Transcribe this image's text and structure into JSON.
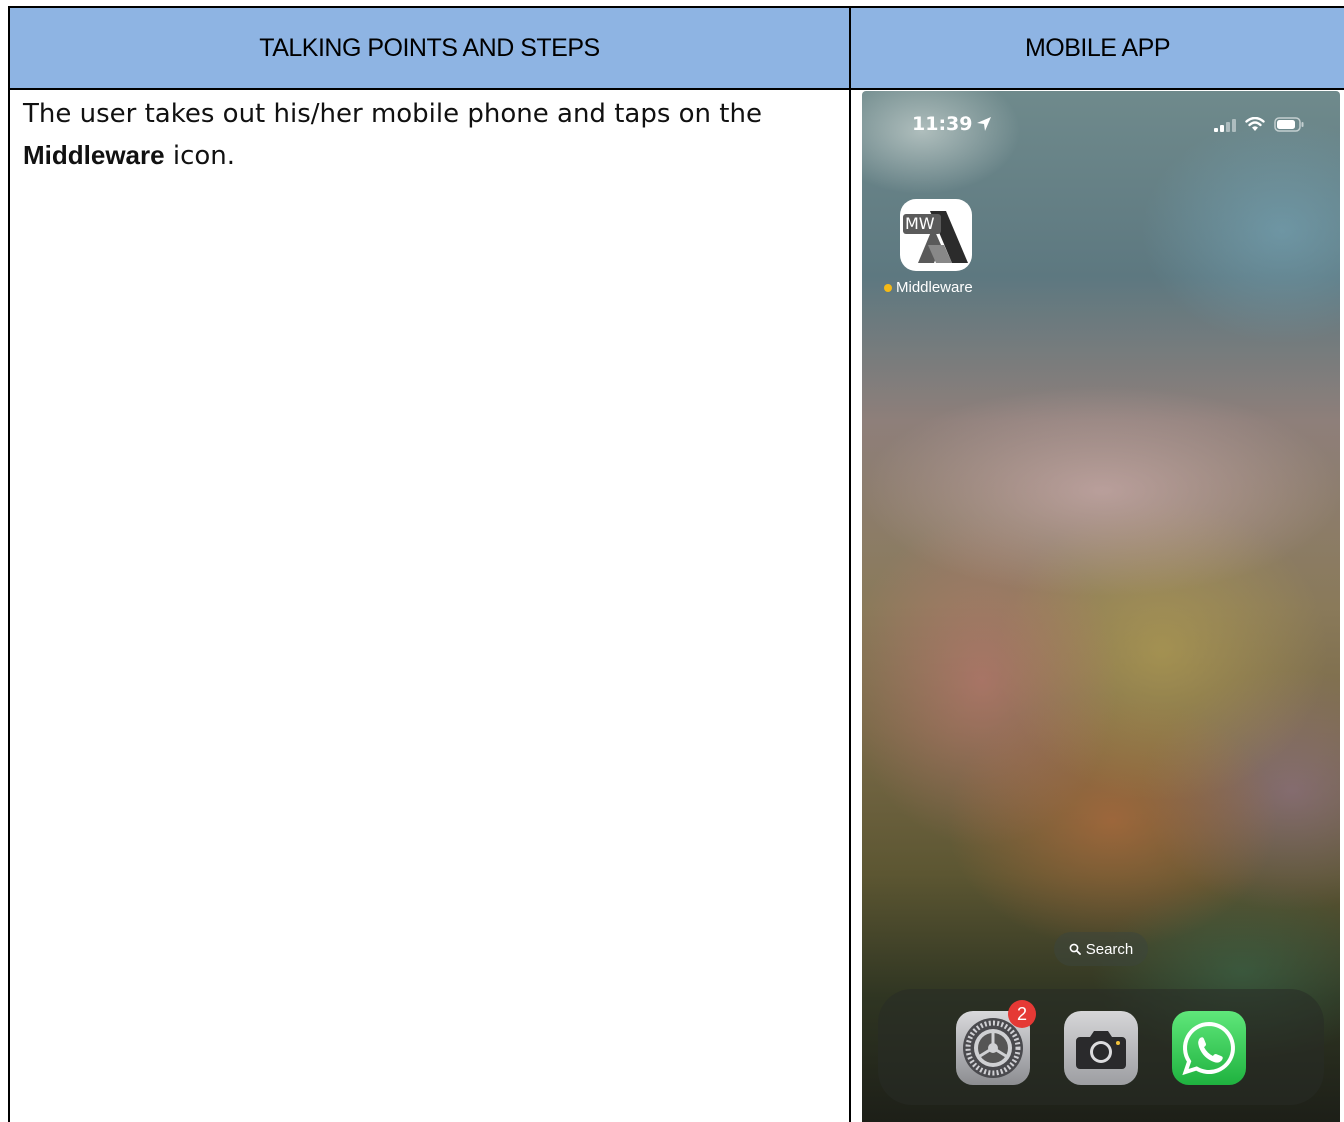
{
  "table": {
    "col1_header": "TALKING POINTS AND STEPS",
    "col2_header": "MOBILE APP",
    "step_text_before": "The user takes out his/her mobile phone and taps on the ",
    "step_text_bold": "Middleware",
    "step_text_after": " icon."
  },
  "phone": {
    "status_time": "11:39",
    "app_icon_text": "MW",
    "app_label": "Middleware",
    "search_label": "Search",
    "settings_badge": "2",
    "dock_apps": [
      "Settings",
      "Camera",
      "WhatsApp"
    ]
  },
  "colors": {
    "header_bg": "#8eb4e3",
    "badge": "#e53935",
    "whatsapp": "#25d366",
    "new_app_dot": "#f5b915"
  }
}
